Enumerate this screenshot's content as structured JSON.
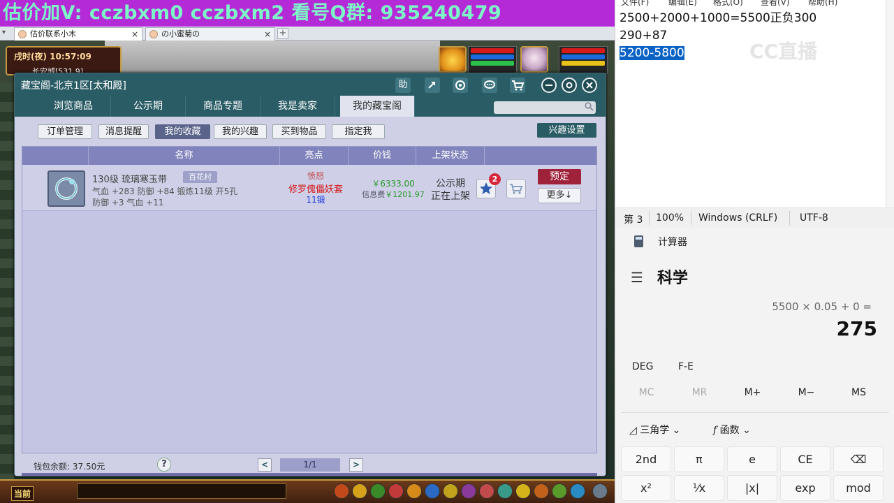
{
  "banner": {
    "text": "估价加V:   cczbxm0   cczbxm2   看号Q群: 935240479"
  },
  "browser": {
    "tabs": [
      {
        "label": "估价联系小木",
        "close": "×"
      },
      {
        "label": "の小蜜菊の",
        "close": "×"
      }
    ],
    "new_tab": "+",
    "menu": "▾"
  },
  "game": {
    "clock_time": "戌时(夜) 10:57:09",
    "location": "长安城[531,9]",
    "current": "当前"
  },
  "dialog": {
    "title": "藏宝阁-北京1区[太和殿]",
    "toolbar_icons": [
      "help-icon",
      "share-icon",
      "record-icon",
      "chat-icon",
      "cart-icon",
      "minimize-icon",
      "settings-icon",
      "close-icon"
    ],
    "help_label": "助",
    "nav_tabs": [
      "浏览商品",
      "公示期",
      "商品专题",
      "我是卖家",
      "我的藏宝阁"
    ],
    "sub_buttons": [
      "订单管理",
      "消息提醒",
      "我的收藏",
      "我的兴趣",
      "买到物品",
      "指定我"
    ],
    "interest_settings": "兴趣设置",
    "columns": [
      "名称",
      "亮点",
      "价钱",
      "上架状态"
    ],
    "item": {
      "name": "130级  琉璃寒玉带",
      "server": "百花村",
      "stats_1": "气血 +283 防御 +84 锻炼11级 开5孔",
      "stats_2": "防御 +3 气血 +11",
      "highlight_1": "愤怒",
      "highlight_2": "修罗傀儡妖套",
      "highlight_3": "11锻",
      "price": "￥6333.00",
      "fee_label": "信息费",
      "fee": "￥1201.97",
      "status_1": "公示期",
      "status_2": "正在上架",
      "fav_count": "2",
      "reserve": "预定",
      "more": "更多↓"
    },
    "wallet": "钱包余额: 37.50元",
    "help": "?",
    "page": "1/1",
    "prev": "<",
    "next": ">"
  },
  "notepad": {
    "menu": [
      "文件(F)",
      "编辑(E)",
      "格式(O)",
      "查看(V)",
      "帮助(H)"
    ],
    "lines": [
      "2500+2000+1000=5500正负300",
      "290+87",
      "5200-5800"
    ],
    "status": {
      "line": "第 3",
      "zoom": "100%",
      "eol": "Windows (CRLF)",
      "enc": "UTF-8"
    },
    "watermark": "CC直播"
  },
  "calculator": {
    "title": "计算器",
    "mode": "科学",
    "expression": "5500 × 0.05 + 0 =",
    "result": "275",
    "flags": [
      "DEG",
      "F-E"
    ],
    "memory": [
      "MC",
      "MR",
      "M+",
      "M−",
      "MS"
    ],
    "menus": [
      "三角学",
      "函数"
    ],
    "keys_row1": [
      "2nd",
      "π",
      "e",
      "CE",
      "⌫"
    ],
    "keys_row2": [
      "x²",
      "¹⁄x",
      "|x|",
      "exp",
      "mod"
    ]
  }
}
